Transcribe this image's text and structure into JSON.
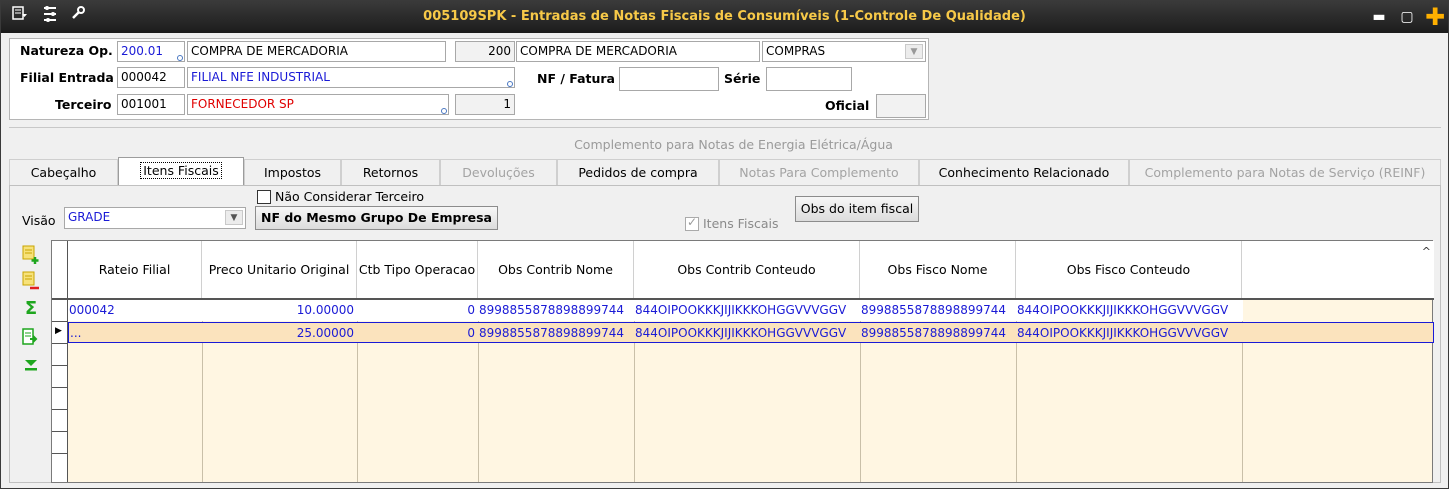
{
  "window": {
    "title": "005109SPK - Entradas de Notas Fiscais de Consumíveis (1-Controle De Qualidade)"
  },
  "header": {
    "natureza_label": "Natureza Op.",
    "natureza_code": "200.01",
    "natureza_desc": "COMPRA DE MERCADORIA",
    "natureza_code2": "200",
    "natureza_desc2": "COMPRA DE MERCADORIA",
    "natureza_type": "COMPRAS",
    "filial_label": "Filial Entrada",
    "filial_code": "000042",
    "filial_name": "FILIAL NFE INDUSTRIAL",
    "nf_label": "NF / Fatura",
    "nf_value": "",
    "serie_label": "Série",
    "serie_value": "",
    "terceiro_label": "Terceiro",
    "terceiro_code": "001001",
    "terceiro_name": "FORNECEDOR SP",
    "terceiro_seq": "1",
    "oficial_label": "Oficial",
    "oficial_value": ""
  },
  "tabs_top_label": "Complemento para Notas de Energia Elétrica/Água",
  "tabs": [
    {
      "label": "Cabeçalho"
    },
    {
      "label": "Itens Fiscais"
    },
    {
      "label": "Impostos"
    },
    {
      "label": "Retornos"
    },
    {
      "label": "Devoluções"
    },
    {
      "label": "Pedidos de compra"
    },
    {
      "label": "Notas Para Complemento"
    },
    {
      "label": "Conhecimento Relacionado"
    },
    {
      "label": "Complemento para Notas de Serviço (REINF)"
    }
  ],
  "itens": {
    "nao_considerar_label": "Não Considerar Terceiro",
    "visao_label": "Visão",
    "visao_value": "GRADE",
    "nf_grupo_button": "NF do Mesmo Grupo De Empresa",
    "itens_fiscais_check_label": "Itens Fiscais",
    "obs_item_button": "Obs do item fiscal"
  },
  "grid": {
    "columns": [
      "Rateio Filial",
      "Preco Unitario Original",
      "Ctb Tipo Operacao",
      "Obs Contrib Nome",
      "Obs Contrib Conteudo",
      "Obs Fisco Nome",
      "Obs Fisco Conteudo"
    ],
    "rows": [
      [
        "000042",
        "10.00000",
        "0",
        "8998855878898899744",
        "844OIPOOKKKJIJIKKKOHGGVVVGGV",
        "8998855878898899744",
        "844OIPOOKKKJIJIKKKOHGGVVVGGV"
      ],
      [
        "...",
        "25.00000",
        "0",
        "8998855878898899744",
        "844OIPOOKKKJIJIKKKOHGGVVVGGV",
        "8998855878898899744",
        "844OIPOOKKKJIJIKKKOHGGVVVGGV"
      ]
    ]
  },
  "icons": {
    "side": [
      "add-row-icon",
      "delete-row-icon",
      "sum-icon",
      "export-icon",
      "move-last-icon"
    ],
    "title": [
      "menu-icon",
      "options-icon",
      "tools-icon"
    ]
  },
  "colors": {
    "title_text": "#f7c948",
    "link_blue": "#1a1ad6",
    "red_text": "#e00000",
    "grid_bg": "#fff6e2",
    "selected_row": "#fbe3bd"
  }
}
